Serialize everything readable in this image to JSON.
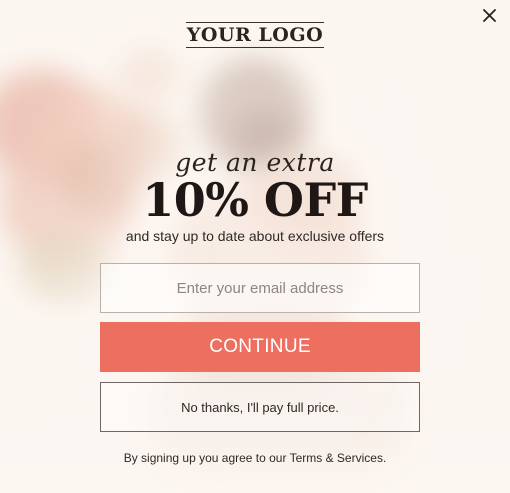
{
  "popup": {
    "logo_text": "YOUR LOGO",
    "headline_script": "get an extra",
    "headline_offer": "10% OFF",
    "subline": "and stay up to date about exclusive offers",
    "email_placeholder": "Enter your email address",
    "email_value": "",
    "continue_label": "CONTINUE",
    "decline_label": "No thanks, I'll pay full price.",
    "disclaimer_prefix": "By signing up you agree to our ",
    "disclaimer_link": "Terms & Services",
    "disclaimer_suffix": "."
  },
  "icons": {
    "close": "close-icon"
  },
  "colors": {
    "accent": "#ec6f60",
    "background": "#fcf6f1",
    "text": "#2b2320"
  }
}
